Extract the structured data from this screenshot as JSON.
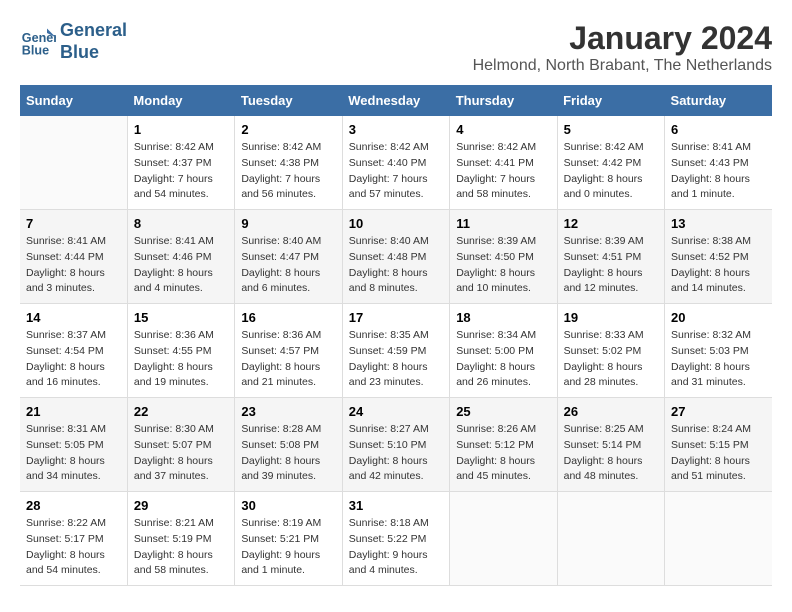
{
  "logo": {
    "line1": "General",
    "line2": "Blue"
  },
  "title": "January 2024",
  "location": "Helmond, North Brabant, The Netherlands",
  "days_of_week": [
    "Sunday",
    "Monday",
    "Tuesday",
    "Wednesday",
    "Thursday",
    "Friday",
    "Saturday"
  ],
  "weeks": [
    [
      {
        "day": "",
        "info": ""
      },
      {
        "day": "1",
        "info": "Sunrise: 8:42 AM\nSunset: 4:37 PM\nDaylight: 7 hours\nand 54 minutes."
      },
      {
        "day": "2",
        "info": "Sunrise: 8:42 AM\nSunset: 4:38 PM\nDaylight: 7 hours\nand 56 minutes."
      },
      {
        "day": "3",
        "info": "Sunrise: 8:42 AM\nSunset: 4:40 PM\nDaylight: 7 hours\nand 57 minutes."
      },
      {
        "day": "4",
        "info": "Sunrise: 8:42 AM\nSunset: 4:41 PM\nDaylight: 7 hours\nand 58 minutes."
      },
      {
        "day": "5",
        "info": "Sunrise: 8:42 AM\nSunset: 4:42 PM\nDaylight: 8 hours\nand 0 minutes."
      },
      {
        "day": "6",
        "info": "Sunrise: 8:41 AM\nSunset: 4:43 PM\nDaylight: 8 hours\nand 1 minute."
      }
    ],
    [
      {
        "day": "7",
        "info": "Sunrise: 8:41 AM\nSunset: 4:44 PM\nDaylight: 8 hours\nand 3 minutes."
      },
      {
        "day": "8",
        "info": "Sunrise: 8:41 AM\nSunset: 4:46 PM\nDaylight: 8 hours\nand 4 minutes."
      },
      {
        "day": "9",
        "info": "Sunrise: 8:40 AM\nSunset: 4:47 PM\nDaylight: 8 hours\nand 6 minutes."
      },
      {
        "day": "10",
        "info": "Sunrise: 8:40 AM\nSunset: 4:48 PM\nDaylight: 8 hours\nand 8 minutes."
      },
      {
        "day": "11",
        "info": "Sunrise: 8:39 AM\nSunset: 4:50 PM\nDaylight: 8 hours\nand 10 minutes."
      },
      {
        "day": "12",
        "info": "Sunrise: 8:39 AM\nSunset: 4:51 PM\nDaylight: 8 hours\nand 12 minutes."
      },
      {
        "day": "13",
        "info": "Sunrise: 8:38 AM\nSunset: 4:52 PM\nDaylight: 8 hours\nand 14 minutes."
      }
    ],
    [
      {
        "day": "14",
        "info": "Sunrise: 8:37 AM\nSunset: 4:54 PM\nDaylight: 8 hours\nand 16 minutes."
      },
      {
        "day": "15",
        "info": "Sunrise: 8:36 AM\nSunset: 4:55 PM\nDaylight: 8 hours\nand 19 minutes."
      },
      {
        "day": "16",
        "info": "Sunrise: 8:36 AM\nSunset: 4:57 PM\nDaylight: 8 hours\nand 21 minutes."
      },
      {
        "day": "17",
        "info": "Sunrise: 8:35 AM\nSunset: 4:59 PM\nDaylight: 8 hours\nand 23 minutes."
      },
      {
        "day": "18",
        "info": "Sunrise: 8:34 AM\nSunset: 5:00 PM\nDaylight: 8 hours\nand 26 minutes."
      },
      {
        "day": "19",
        "info": "Sunrise: 8:33 AM\nSunset: 5:02 PM\nDaylight: 8 hours\nand 28 minutes."
      },
      {
        "day": "20",
        "info": "Sunrise: 8:32 AM\nSunset: 5:03 PM\nDaylight: 8 hours\nand 31 minutes."
      }
    ],
    [
      {
        "day": "21",
        "info": "Sunrise: 8:31 AM\nSunset: 5:05 PM\nDaylight: 8 hours\nand 34 minutes."
      },
      {
        "day": "22",
        "info": "Sunrise: 8:30 AM\nSunset: 5:07 PM\nDaylight: 8 hours\nand 37 minutes."
      },
      {
        "day": "23",
        "info": "Sunrise: 8:28 AM\nSunset: 5:08 PM\nDaylight: 8 hours\nand 39 minutes."
      },
      {
        "day": "24",
        "info": "Sunrise: 8:27 AM\nSunset: 5:10 PM\nDaylight: 8 hours\nand 42 minutes."
      },
      {
        "day": "25",
        "info": "Sunrise: 8:26 AM\nSunset: 5:12 PM\nDaylight: 8 hours\nand 45 minutes."
      },
      {
        "day": "26",
        "info": "Sunrise: 8:25 AM\nSunset: 5:14 PM\nDaylight: 8 hours\nand 48 minutes."
      },
      {
        "day": "27",
        "info": "Sunrise: 8:24 AM\nSunset: 5:15 PM\nDaylight: 8 hours\nand 51 minutes."
      }
    ],
    [
      {
        "day": "28",
        "info": "Sunrise: 8:22 AM\nSunset: 5:17 PM\nDaylight: 8 hours\nand 54 minutes."
      },
      {
        "day": "29",
        "info": "Sunrise: 8:21 AM\nSunset: 5:19 PM\nDaylight: 8 hours\nand 58 minutes."
      },
      {
        "day": "30",
        "info": "Sunrise: 8:19 AM\nSunset: 5:21 PM\nDaylight: 9 hours\nand 1 minute."
      },
      {
        "day": "31",
        "info": "Sunrise: 8:18 AM\nSunset: 5:22 PM\nDaylight: 9 hours\nand 4 minutes."
      },
      {
        "day": "",
        "info": ""
      },
      {
        "day": "",
        "info": ""
      },
      {
        "day": "",
        "info": ""
      }
    ]
  ]
}
